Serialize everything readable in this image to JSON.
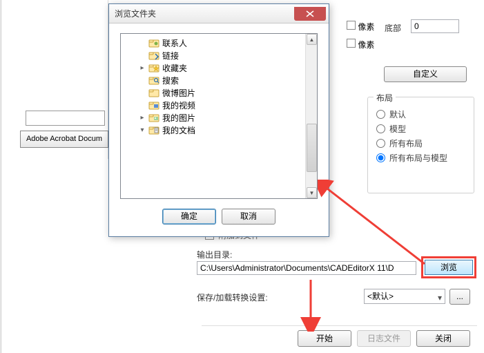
{
  "left": {
    "adobe_button": "Adobe Acrobat Docum"
  },
  "top_right": {
    "bottom_label": "底部",
    "bottom_value": "0",
    "pixel_label": "像素",
    "custom_button": "自定义"
  },
  "layout": {
    "title": "布局",
    "options": {
      "default": "默认",
      "model": "模型",
      "all_layouts": "所有布局",
      "all_layouts_and_model": "所有布局与模型"
    },
    "selected": "all_layouts_and_model"
  },
  "dialog": {
    "title": "浏览文件夹",
    "tree": [
      {
        "label": "联系人",
        "depth": 1,
        "icon": "contacts",
        "expander": ""
      },
      {
        "label": "链接",
        "depth": 1,
        "icon": "links",
        "expander": ""
      },
      {
        "label": "收藏夹",
        "depth": 1,
        "icon": "favorites",
        "expander": "▸"
      },
      {
        "label": "搜索",
        "depth": 1,
        "icon": "search",
        "expander": ""
      },
      {
        "label": "微博图片",
        "depth": 1,
        "icon": "folder",
        "expander": ""
      },
      {
        "label": "我的视频",
        "depth": 1,
        "icon": "video",
        "expander": ""
      },
      {
        "label": "我的图片",
        "depth": 1,
        "icon": "pictures",
        "expander": "▸"
      },
      {
        "label": "我的文档",
        "depth": 1,
        "icon": "documents",
        "expander": "▾"
      }
    ],
    "ok": "确定",
    "cancel": "取消"
  },
  "output": {
    "attach_label": "附加到文件",
    "dir_label": "输出目录:",
    "dir_value": "C:\\Users\\Administrator\\Documents\\CADEditorX 11\\D",
    "browse": "浏览"
  },
  "save_settings": {
    "label": "保存/加载转换设置:",
    "value": "<默认>"
  },
  "bottom": {
    "start": "开始",
    "log": "日志文件",
    "close": "关闭"
  }
}
